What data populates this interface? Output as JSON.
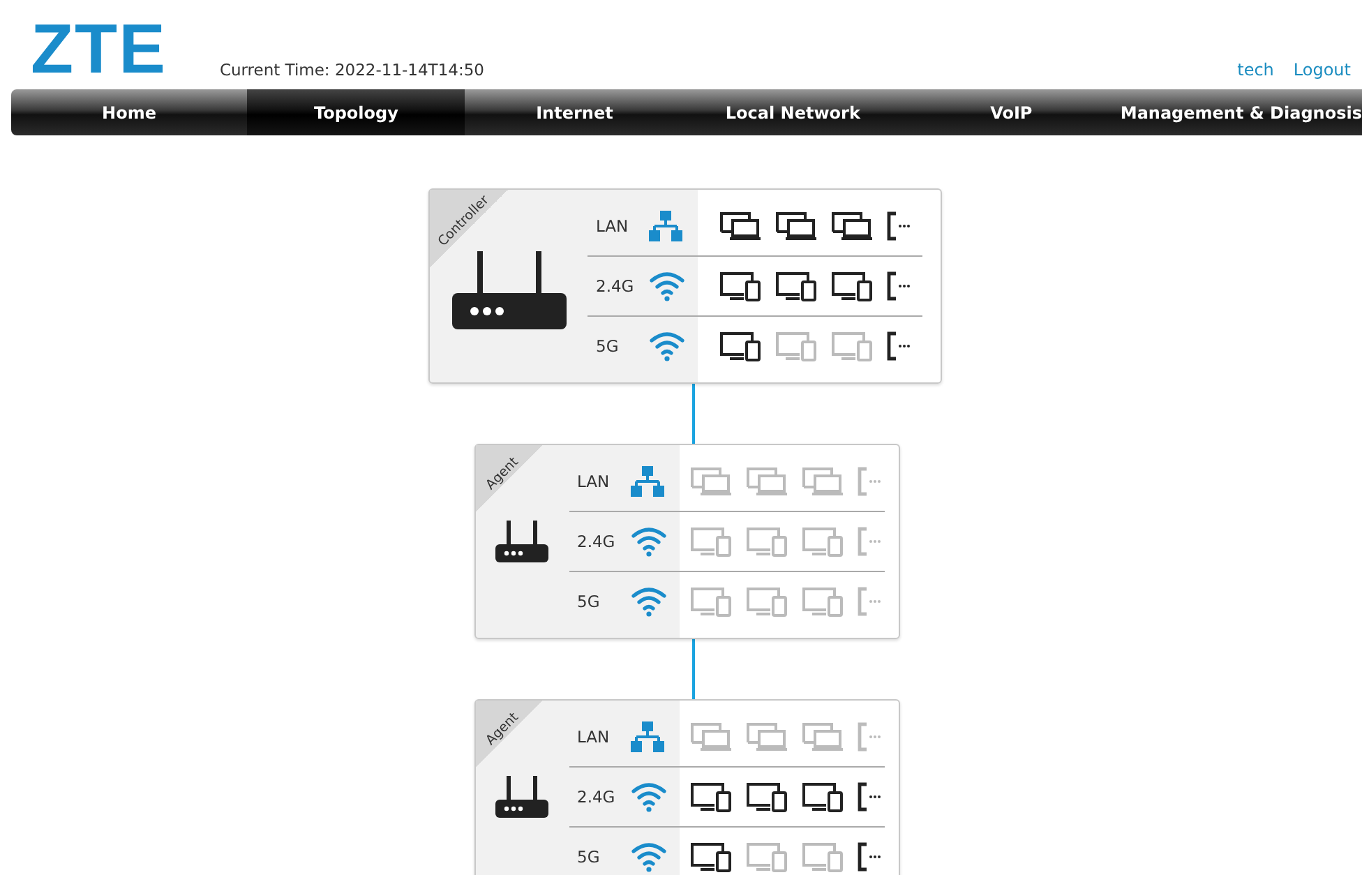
{
  "header": {
    "logo": "ZTE",
    "current_time": "Current Time: 2022-11-14T14:50",
    "user": "tech",
    "logout": "Logout"
  },
  "nav": [
    {
      "label": "Home",
      "selected": false
    },
    {
      "label": "Topology",
      "selected": true
    },
    {
      "label": "Internet",
      "selected": false
    },
    {
      "label": "Local Network",
      "selected": false
    },
    {
      "label": "VoIP",
      "selected": false
    },
    {
      "label": "Management & Diagnosis",
      "selected": false
    }
  ],
  "nodes": [
    {
      "kind": "controller",
      "role": "Controller",
      "rows": [
        {
          "band": "LAN",
          "kind": "lan",
          "devices": [
            {
              "active": true
            },
            {
              "active": true
            },
            {
              "active": true
            }
          ],
          "more": {
            "active": true
          }
        },
        {
          "band": "2.4G",
          "kind": "wifi",
          "devices": [
            {
              "active": true
            },
            {
              "active": true
            },
            {
              "active": true
            }
          ],
          "more": {
            "active": true
          }
        },
        {
          "band": "5G",
          "kind": "wifi",
          "devices": [
            {
              "active": true
            },
            {
              "active": false
            },
            {
              "active": false
            }
          ],
          "more": {
            "active": true
          }
        }
      ]
    },
    {
      "kind": "agent",
      "role": "Agent",
      "rows": [
        {
          "band": "LAN",
          "kind": "lan",
          "devices": [
            {
              "active": false
            },
            {
              "active": false
            },
            {
              "active": false
            }
          ],
          "more": {
            "active": false
          }
        },
        {
          "band": "2.4G",
          "kind": "wifi",
          "devices": [
            {
              "active": false
            },
            {
              "active": false
            },
            {
              "active": false
            }
          ],
          "more": {
            "active": false
          }
        },
        {
          "band": "5G",
          "kind": "wifi",
          "devices": [
            {
              "active": false
            },
            {
              "active": false
            },
            {
              "active": false
            }
          ],
          "more": {
            "active": false
          }
        }
      ]
    },
    {
      "kind": "agent",
      "role": "Agent",
      "rows": [
        {
          "band": "LAN",
          "kind": "lan",
          "devices": [
            {
              "active": false
            },
            {
              "active": false
            },
            {
              "active": false
            }
          ],
          "more": {
            "active": false
          }
        },
        {
          "band": "2.4G",
          "kind": "wifi",
          "devices": [
            {
              "active": true
            },
            {
              "active": true
            },
            {
              "active": true
            }
          ],
          "more": {
            "active": true
          }
        },
        {
          "band": "5G",
          "kind": "wifi",
          "devices": [
            {
              "active": true
            },
            {
              "active": false
            },
            {
              "active": false
            }
          ],
          "more": {
            "active": true
          }
        }
      ]
    }
  ]
}
